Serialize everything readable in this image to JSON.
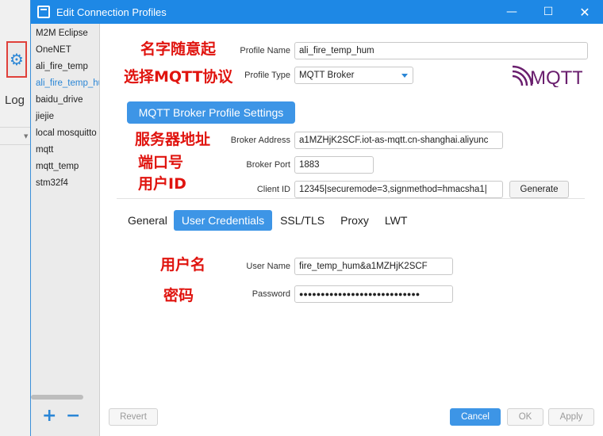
{
  "background_app": {
    "log_label": "Log"
  },
  "window": {
    "title": "Edit Connection Profiles"
  },
  "sidebar": {
    "items": [
      {
        "label": "M2M Eclipse"
      },
      {
        "label": "OneNET"
      },
      {
        "label": "ali_fire_temp"
      },
      {
        "label": "ali_fire_temp_hum"
      },
      {
        "label": "baidu_drive"
      },
      {
        "label": "jiejie"
      },
      {
        "label": "local mosquitto"
      },
      {
        "label": "mqtt"
      },
      {
        "label": "mqtt_temp"
      },
      {
        "label": "stm32f4"
      }
    ],
    "active_index": 3,
    "add_label": "+",
    "remove_label": "−"
  },
  "annotations": {
    "profile_name": "名字随意起",
    "profile_type": "选择MQTT协议",
    "broker_address": "服务器地址",
    "broker_port": "端口号",
    "client_id": "用户ID",
    "user_name": "用户名",
    "password": "密码"
  },
  "form": {
    "profile_name_label": "Profile Name",
    "profile_name_value": "ali_fire_temp_hum",
    "profile_type_label": "Profile Type",
    "profile_type_value": "MQTT Broker",
    "section_title": "MQTT Broker Profile Settings",
    "broker_address_label": "Broker Address",
    "broker_address_value": "a1MZHjK2SCF.iot-as-mqtt.cn-shanghai.aliyunc",
    "broker_port_label": "Broker Port",
    "broker_port_value": "1883",
    "client_id_label": "Client ID",
    "client_id_value": "12345|securemode=3,signmethod=hmacsha1|",
    "generate_label": "Generate"
  },
  "logo": {
    "text": "MQTT",
    "color": "#6a1f6e"
  },
  "tabs": [
    {
      "label": "General"
    },
    {
      "label": "User Credentials"
    },
    {
      "label": "SSL/TLS"
    },
    {
      "label": "Proxy"
    },
    {
      "label": "LWT"
    }
  ],
  "credentials": {
    "user_name_label": "User Name",
    "user_name_value": "fire_temp_hum&a1MZHjK2SCF",
    "password_label": "Password",
    "password_value": "●●●●●●●●●●●●●●●●●●●●●●●●●●●●"
  },
  "footer": {
    "revert_label": "Revert",
    "cancel_label": "Cancel",
    "ok_label": "OK",
    "apply_label": "Apply"
  },
  "colors": {
    "accent": "#3d95e6",
    "titlebar": "#1e88e5",
    "annotation": "#e0140f"
  }
}
